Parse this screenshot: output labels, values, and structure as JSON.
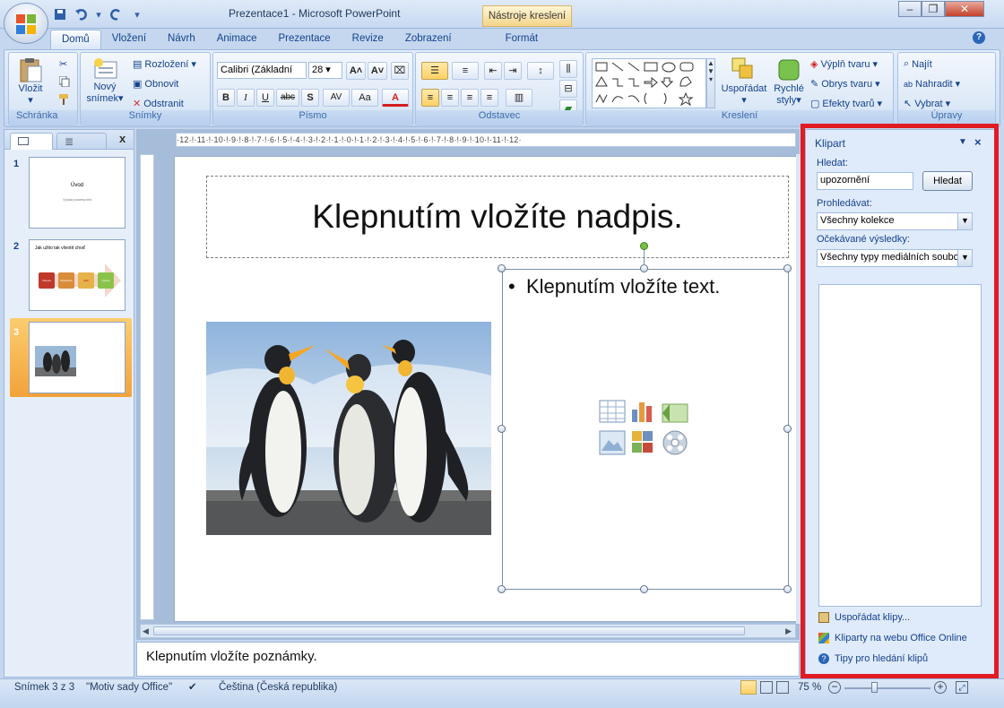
{
  "window": {
    "title": "Prezentace1 - Microsoft PowerPoint",
    "context_tab": "Nástroje kreslení",
    "minimize": "–",
    "restore": "❐",
    "close": "✕"
  },
  "tabs": [
    "Domů",
    "Vložení",
    "Návrh",
    "Animace",
    "Prezentace",
    "Revize",
    "Zobrazení",
    "Formát"
  ],
  "ribbon": {
    "clipboard": {
      "label": "Schránka",
      "paste": "Vložit"
    },
    "slides": {
      "label": "Snímky",
      "new_slide_1": "Nový",
      "new_slide_2": "snímek",
      "layout": "Rozložení",
      "reset": "Obnovit",
      "delete": "Odstranit"
    },
    "font": {
      "label": "Písmo",
      "font_name": "Calibri (Základní",
      "font_size": "28",
      "bold": "B",
      "italic": "I",
      "underline": "U",
      "strike": "abc",
      "shadow": "S",
      "spacing": "AV",
      "case": "Aa",
      "color": "A"
    },
    "paragraph": {
      "label": "Odstavec"
    },
    "drawing": {
      "label": "Kreslení",
      "arrange": "Uspořádat",
      "quick_styles_1": "Rychlé",
      "quick_styles_2": "styly",
      "fill": "Výplň tvaru",
      "outline": "Obrys tvaru",
      "effects": "Efekty tvarů"
    },
    "editing": {
      "label": "Úpravy",
      "find": "Najít",
      "replace": "Nahradit",
      "select": "Vybrat"
    }
  },
  "left_pane": {
    "close": "x",
    "slides": [
      {
        "num": "1",
        "title": "Úvod",
        "subtitle": "Výuka powerpoint"
      },
      {
        "num": "2",
        "title": "Jak užito tak vlivotě choď",
        "boxes": [
          "Vstupní",
          "Realizace",
          "Zisk",
          "Výstup"
        ]
      },
      {
        "num": "3"
      }
    ]
  },
  "ruler": {
    "h": "·12·!·11·!·10·!·9·!·8·!·7·!·6·!·5·!·4·!·3·!·2·!·1·!·0·!·1·!·2·!·3·!·4·!·5·!·6·!·7·!·8·!·9·!·10·!·11·!·12·"
  },
  "slide": {
    "title_placeholder": "Klepnutím vložíte nadpis.",
    "content_placeholder": "Klepnutím vložíte text."
  },
  "notes": {
    "placeholder": "Klepnutím vložíte poznámky."
  },
  "task_pane": {
    "title": "Klipart",
    "search_label": "Hledat:",
    "search_value": "upozornění",
    "search_button": "Hledat",
    "browse_label": "Prohledávat:",
    "browse_value": "Všechny kolekce",
    "results_label": "Očekávané výsledky:",
    "results_value": "Všechny typy mediálních soubor",
    "links": [
      "Uspořádat klipy...",
      "Kliparty na webu Office Online",
      "Tipy pro hledání klipů"
    ]
  },
  "status": {
    "slide": "Snímek 3 z 3",
    "theme": "\"Motiv sady Office\"",
    "language": "Čeština (Česká republika)",
    "zoom": "75 %"
  },
  "colors": {
    "accent": "#15428b",
    "highlight": "#e11b22",
    "selection": "#f3a23a"
  }
}
